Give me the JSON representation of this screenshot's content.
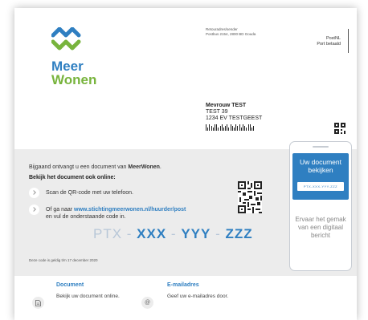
{
  "logo": {
    "line1": "Meer",
    "line2": "Wonen",
    "colors": {
      "blue": "#2f7fc1",
      "green": "#78b43d"
    }
  },
  "sender": {
    "line1": "Retouradres/sender",
    "line2": "Postbus 2154, 2800 BD Gouda"
  },
  "postage": {
    "line1": "PostNL",
    "line2": "Port betaald"
  },
  "recipient": {
    "name": "Mevrouw TEST",
    "street": "TEST 39",
    "city": "1234 EV TESTGEEST"
  },
  "letter": {
    "intro_prefix": "Bijgaand ontvangt u een document van ",
    "intro_brand": "MeerWonen",
    "intro_suffix": ".",
    "online_heading": "Bekijk het document ook online:",
    "step1": "Scan de QR-code met uw telefoon.",
    "step2_prefix": "Of ga naar ",
    "step2_link": "www.stichtingmeerwonen.nl/huurder/post",
    "step2_suffix": "en vul de onderstaande code in.",
    "code_prefix": "PTX",
    "code_part2": "XXX",
    "code_part3": "YYY",
    "code_part4": "ZZZ",
    "valid_text": "Deze code is geldig t/m 17 december 2020"
  },
  "phone": {
    "screen_title": "Uw document bekijken",
    "screen_code": "PTX-XXX-YYY-ZZZ",
    "message": "Ervaar het gemak van een digitaal bericht"
  },
  "features": [
    {
      "icon": "document-icon",
      "title": "Document",
      "text": "Bekijk uw document online."
    },
    {
      "icon": "at-sign-icon",
      "title": "E-mailadres",
      "text": "Geef uw e-mailadres door."
    }
  ],
  "accent_color": "#2f7fc1"
}
